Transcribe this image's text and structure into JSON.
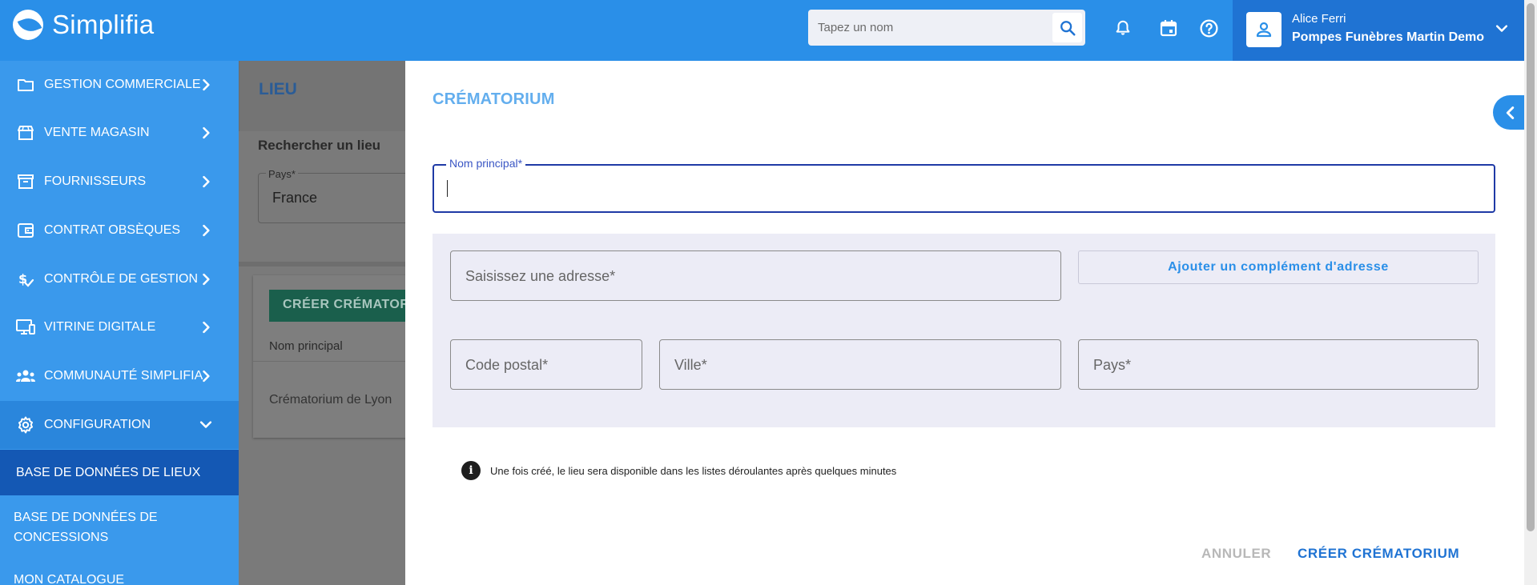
{
  "app": {
    "logo_text": "Simplifia"
  },
  "search": {
    "placeholder": "Tapez un nom"
  },
  "header_icons": [
    "bell-icon",
    "calendar-icon",
    "help-icon"
  ],
  "user": {
    "name": "Alice Ferri",
    "company": "Pompes Funèbres Martin Demo"
  },
  "sidebar": {
    "items": [
      {
        "label": "GESTION COMMERCIALE",
        "icon": "folder-icon"
      },
      {
        "label": "VENTE MAGASIN",
        "icon": "store-icon"
      },
      {
        "label": "FOURNISSEURS",
        "icon": "archive-icon"
      },
      {
        "label": "CONTRAT OBSÈQUES",
        "icon": "wallet-icon"
      },
      {
        "label": "CONTRÔLE DE GESTION",
        "icon": "money-check-icon"
      },
      {
        "label": "VITRINE DIGITALE",
        "icon": "monitor-icon"
      },
      {
        "label": "COMMUNAUTÉ SIMPLIFIA",
        "icon": "people-icon"
      },
      {
        "label": "CONFIGURATION",
        "icon": "gear-icon",
        "expanded": true
      }
    ],
    "subitems": [
      {
        "label": "BASE DE DONNÉES DE LIEUX",
        "selected": true
      },
      {
        "label": "BASE DE DONNÉES DE CONCESSIONS"
      },
      {
        "label": "MON CATALOGUE"
      }
    ]
  },
  "page": {
    "title": "LIEU",
    "search_label": "Rechercher un lieu",
    "country_label": "Pays*",
    "country_value": "France",
    "create_button": "CRÉER CRÉMATORIUM",
    "table_header": "Nom principal",
    "rows": [
      "Crématorium de Lyon"
    ]
  },
  "drawer": {
    "title": "CRÉMATORIUM",
    "main_name_label": "Nom principal*",
    "main_name_value": "",
    "address_placeholder": "Saisissez une adresse*",
    "address_complement_button": "Ajouter un complément d'adresse",
    "postal_code_placeholder": "Code postal*",
    "city_placeholder": "Ville*",
    "country_placeholder": "Pays*",
    "info_text": "Une fois créé, le lieu sera disponible dans les listes déroulantes après quelques minutes",
    "cancel_button": "ANNULER",
    "create_button": "CRÉER CRÉMATORIUM"
  },
  "colors": {
    "primary": "#2a8fe8",
    "sidebar": "#3a99ec",
    "user_box": "#1f73d3",
    "selected_nav": "#1458b4",
    "input_focus": "#1f3aa6",
    "title_accent": "#63aeee"
  }
}
